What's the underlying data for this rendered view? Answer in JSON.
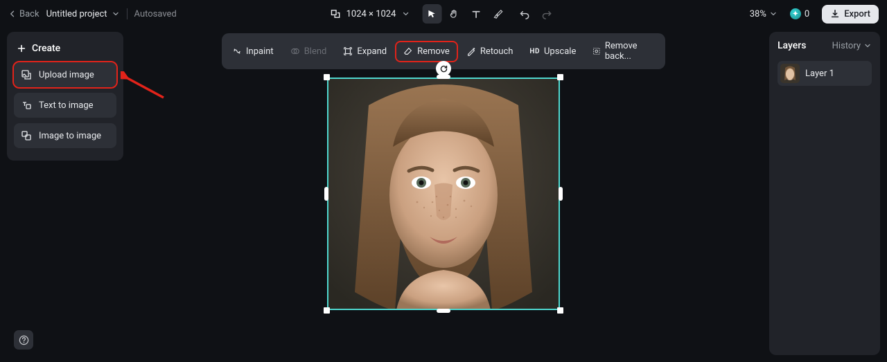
{
  "header": {
    "back": "Back",
    "project_name": "Untitled project",
    "autosave": "Autosaved",
    "dimensions": "1024 × 1024",
    "zoom": "38%",
    "credits": "0",
    "export": "Export"
  },
  "sidebar": {
    "title": "Create",
    "items": [
      {
        "label": "Upload image"
      },
      {
        "label": "Text to image"
      },
      {
        "label": "Image to image"
      }
    ]
  },
  "ai_toolbar": {
    "inpaint": "Inpaint",
    "blend": "Blend",
    "expand": "Expand",
    "remove": "Remove",
    "retouch": "Retouch",
    "upscale": "Upscale",
    "remove_bg": "Remove back..."
  },
  "layers": {
    "title": "Layers",
    "history": "History",
    "items": [
      {
        "name": "Layer 1"
      }
    ]
  },
  "colors": {
    "highlight": "#e2231a",
    "selection": "#4fd8cf"
  }
}
